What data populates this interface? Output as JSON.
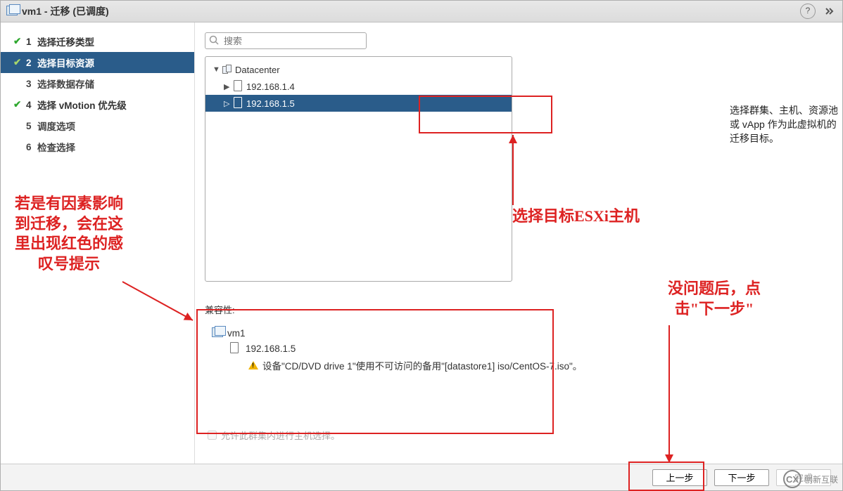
{
  "title": "vm1 - 迁移 (已调度)",
  "help_tooltip": "?",
  "steps": [
    {
      "num": "1",
      "label": "选择迁移类型",
      "state": "completed"
    },
    {
      "num": "2",
      "label": "选择目标资源",
      "state": "active"
    },
    {
      "num": "3",
      "label": "选择数据存储",
      "state": "pending"
    },
    {
      "num": "4",
      "label": "选择 vMotion 优先级",
      "state": "completed"
    },
    {
      "num": "5",
      "label": "调度选项",
      "state": "pending"
    },
    {
      "num": "6",
      "label": "检查选择",
      "state": "pending"
    }
  ],
  "search": {
    "placeholder": "搜索"
  },
  "tree": {
    "root": "Datacenter",
    "children": [
      {
        "label": "192.168.1.4",
        "selected": false
      },
      {
        "label": "192.168.1.5",
        "selected": true
      }
    ]
  },
  "page_instruction": "选择群集、主机、资源池或 vApp 作为此虚拟机的迁移目标。",
  "compat": {
    "title": "兼容性:",
    "vm": "vm1",
    "host": "192.168.1.5",
    "warning": "设备\"CD/DVD drive 1\"使用不可访问的备用\"[datastore1] iso/CentOS-7.iso\"。"
  },
  "allow_cluster_checkbox": "允许此群集内进行主机选择。",
  "buttons": {
    "back": "上一步",
    "next": "下一步",
    "finish": "完成"
  },
  "annotations": {
    "left_note": "若是有因素影响\n到迁移，会在这\n里出现红色的感\n叹号提示",
    "center_note": "选择目标ESXi主机",
    "right_note": "没问题后，点\n击\"下一步\""
  },
  "watermark": "创新互联"
}
